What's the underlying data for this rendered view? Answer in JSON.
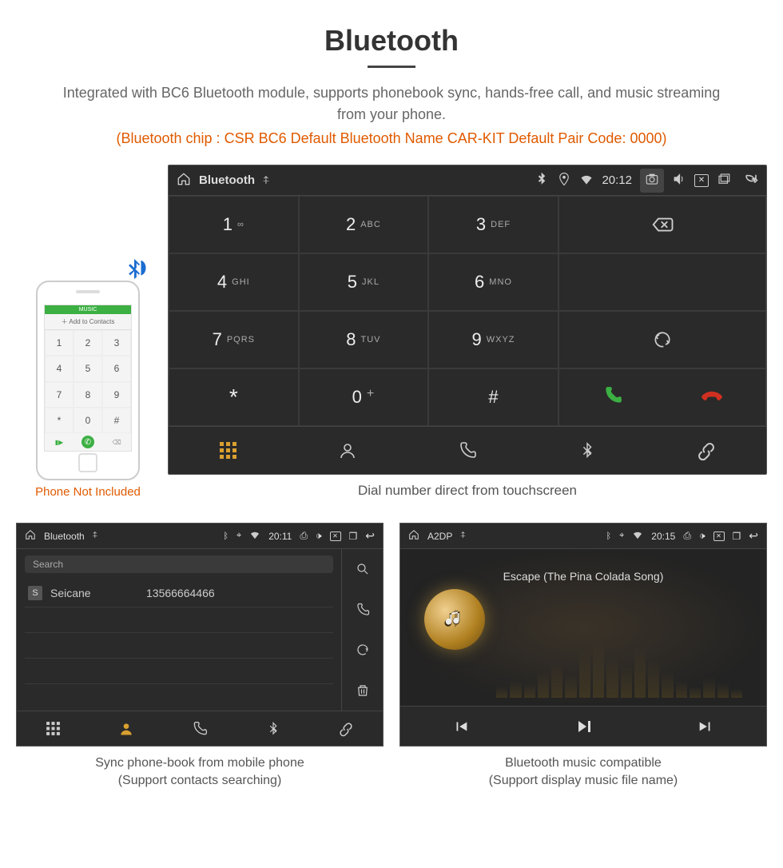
{
  "header": {
    "title": "Bluetooth",
    "description": "Integrated with BC6 Bluetooth module, supports phonebook sync, hands-free call, and music streaming from your phone.",
    "specs": "(Bluetooth chip : CSR BC6     Default Bluetooth Name CAR-KIT     Default Pair Code: 0000)"
  },
  "phone_mock": {
    "top_text": "MUSIC",
    "add_text": "Add to Contacts",
    "note": "Phone Not Included"
  },
  "dialer": {
    "statusbar": {
      "app": "Bluetooth",
      "time": "20:12"
    },
    "keys": [
      {
        "d": "1",
        "s": "∞"
      },
      {
        "d": "2",
        "s": "ABC"
      },
      {
        "d": "3",
        "s": "DEF"
      },
      {
        "d": "4",
        "s": "GHI"
      },
      {
        "d": "5",
        "s": "JKL"
      },
      {
        "d": "6",
        "s": "MNO"
      },
      {
        "d": "7",
        "s": "PQRS"
      },
      {
        "d": "8",
        "s": "TUV"
      },
      {
        "d": "9",
        "s": "WXYZ"
      },
      {
        "d": "*",
        "s": ""
      },
      {
        "d": "0",
        "s": "+"
      },
      {
        "d": "#",
        "s": ""
      }
    ],
    "caption": "Dial number direct from touchscreen"
  },
  "contacts": {
    "statusbar": {
      "app": "Bluetooth",
      "time": "20:11"
    },
    "search_placeholder": "Search",
    "items": [
      {
        "initial": "S",
        "name": "Seicane",
        "number": "13566664466"
      }
    ],
    "caption_line1": "Sync phone-book from mobile phone",
    "caption_line2": "(Support contacts searching)"
  },
  "music": {
    "statusbar": {
      "app": "A2DP",
      "time": "20:15"
    },
    "song_title": "Escape (The Pina Colada Song)",
    "caption_line1": "Bluetooth music compatible",
    "caption_line2": "(Support display music file name)"
  }
}
